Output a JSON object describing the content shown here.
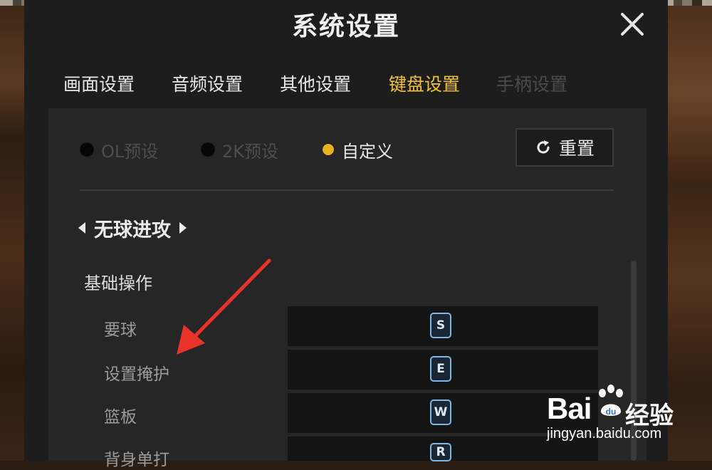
{
  "dialog": {
    "title": "系统设置"
  },
  "tabs": [
    {
      "label": "画面设置",
      "state": "normal"
    },
    {
      "label": "音频设置",
      "state": "normal"
    },
    {
      "label": "其他设置",
      "state": "normal"
    },
    {
      "label": "键盘设置",
      "state": "active"
    },
    {
      "label": "手柄设置",
      "state": "disabled"
    }
  ],
  "presets": [
    {
      "label": "OL预设",
      "selected": false
    },
    {
      "label": "2K预设",
      "selected": false
    },
    {
      "label": "自定义",
      "selected": true
    }
  ],
  "reset_button": {
    "label": "重置",
    "icon": "refresh-icon"
  },
  "section": {
    "title": "无球进攻",
    "prev_icon": "triangle-left-icon",
    "next_icon": "triangle-right-icon"
  },
  "group": {
    "label": "基础操作"
  },
  "bindings": [
    {
      "action": "要球",
      "key": "S"
    },
    {
      "action": "设置掩护",
      "key": "E"
    },
    {
      "action": "篮板",
      "key": "W"
    },
    {
      "action": "背身单打",
      "key": "R"
    }
  ],
  "colors": {
    "accent": "#e2ad21",
    "annotation_arrow": "#e8332b",
    "keycap_border": "#7fb6e3"
  },
  "watermark": {
    "brand": "Bai",
    "brand_cn": "经验",
    "url": "jingyan.baidu.com"
  }
}
